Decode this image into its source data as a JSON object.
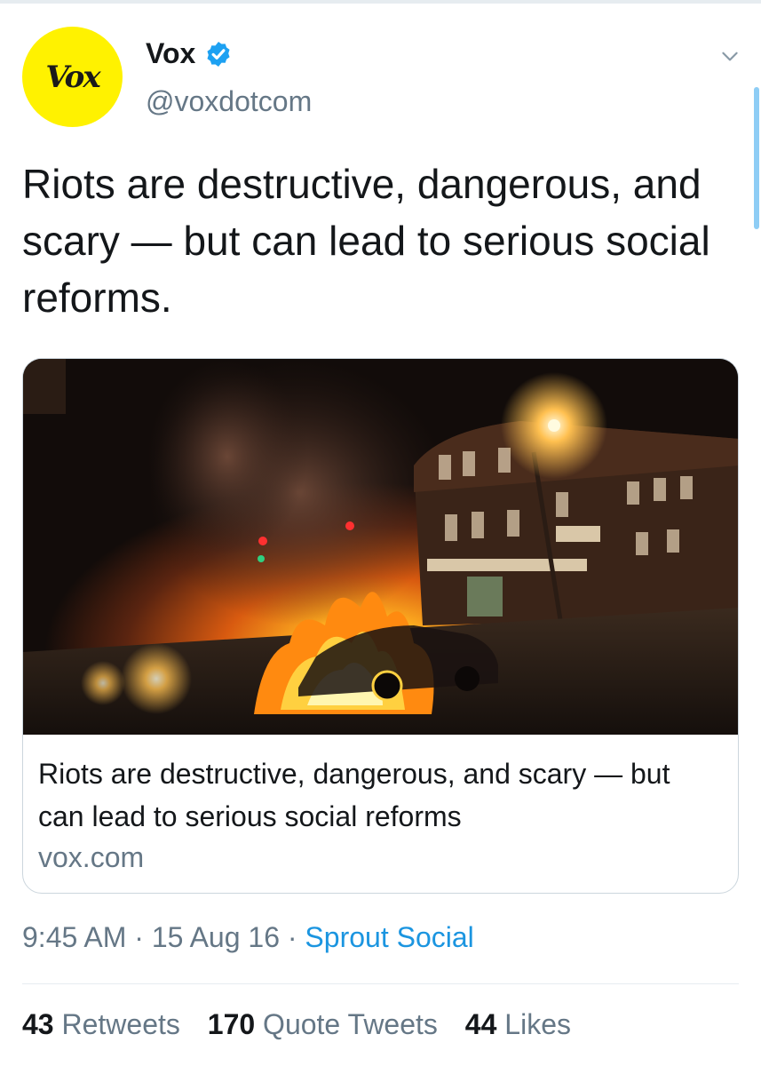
{
  "account": {
    "display_name": "Vox",
    "handle": "@voxdotcom",
    "avatar_text": "Vox",
    "verified": true,
    "avatar_color": "#fff200"
  },
  "tweet": {
    "text": "Riots are destructive, dangerous, and scary — but can lead to serious social reforms."
  },
  "card": {
    "title": "Riots are destructive, dangerous, and scary — but can lead to serious social reforms",
    "domain": "vox.com",
    "image_description_icon": "news-photo"
  },
  "meta": {
    "time": "9:45 AM",
    "separator": "·",
    "date": "15 Aug 16",
    "source": "Sprout Social"
  },
  "stats": {
    "retweets_count": "43",
    "retweets_label": "Retweets",
    "quotes_count": "170",
    "quotes_label": "Quote Tweets",
    "likes_count": "44",
    "likes_label": "Likes"
  },
  "colors": {
    "accent": "#1b95e0",
    "secondary_text": "#657786",
    "verified": "#1da1f2"
  }
}
